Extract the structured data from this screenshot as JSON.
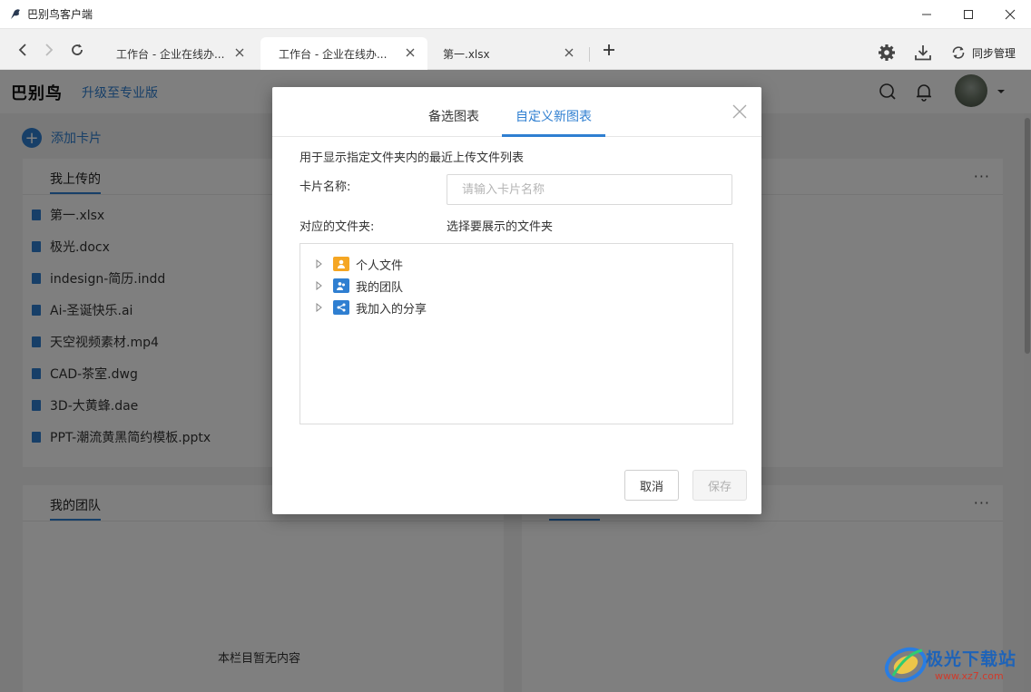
{
  "window": {
    "title": "巴别鸟客户端",
    "controls": [
      "minimize",
      "maximize",
      "close"
    ]
  },
  "tabs": [
    {
      "label": "工作台 - 企业在线办...",
      "active": false
    },
    {
      "label": "工作台 - 企业在线办...",
      "active": true
    },
    {
      "label": "第一.xlsx",
      "active": false
    }
  ],
  "toolbar": {
    "sync_label": "同步管理"
  },
  "header": {
    "brand": "巴别鸟",
    "upgrade": "升级至专业版"
  },
  "content": {
    "add_card": "添加卡片",
    "panels": [
      {
        "title": "我上传的",
        "files": [
          "第一.xlsx",
          "极光.docx",
          "indesign-简历.indd",
          "Ai-圣诞快乐.ai",
          "天空视频素材.mp4",
          "CAD-茶室.dwg",
          "3D-大黄蜂.dae",
          "PPT-潮流黄黑简约模板.pptx"
        ]
      },
      {
        "title": "我的团队",
        "empty_text": "本栏目暂无内容"
      }
    ],
    "more_label": "···"
  },
  "modal": {
    "tabs": [
      {
        "label": "备选图表",
        "active": false
      },
      {
        "label": "自定义新图表",
        "active": true
      }
    ],
    "description": "用于显示指定文件夹内的最近上传文件列表",
    "name_label": "卡片名称:",
    "name_placeholder": "请输入卡片名称",
    "folder_label": "对应的文件夹:",
    "folder_hint": "选择要展示的文件夹",
    "tree": [
      {
        "label": "个人文件",
        "color": "#f5a623",
        "icon": "person-folder-icon"
      },
      {
        "label": "我的团队",
        "color": "#2f7fd1",
        "icon": "team-folder-icon"
      },
      {
        "label": "我加入的分享",
        "color": "#2f7fd1",
        "icon": "share-folder-icon"
      }
    ],
    "cancel": "取消",
    "save": "保存"
  },
  "watermark": {
    "text": "极光下载站",
    "url": "www.xz7.com"
  },
  "colors": {
    "accent": "#2f7fd1",
    "overlay": "rgba(0,0,0,0.5)"
  }
}
